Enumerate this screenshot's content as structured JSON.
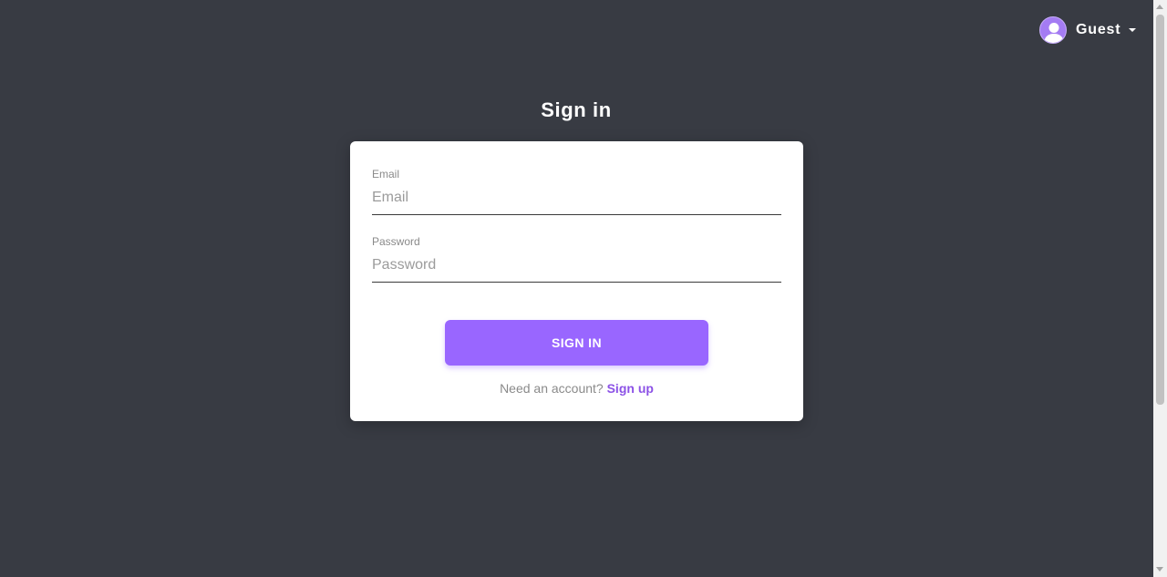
{
  "header": {
    "user_name": "Guest",
    "avatar_icon": "user-avatar-icon",
    "caret_icon": "caret-down-icon"
  },
  "signin": {
    "title": "Sign in",
    "email": {
      "label": "Email",
      "placeholder": "Email",
      "value": ""
    },
    "password": {
      "label": "Password",
      "placeholder": "Password",
      "value": ""
    },
    "submit_label": "SIGN IN",
    "footer_prompt": "Need an account?",
    "footer_link": "Sign up"
  },
  "colors": {
    "background": "#383b43",
    "accent": "#9966ff",
    "link": "#8c52e6",
    "card": "#ffffff"
  }
}
